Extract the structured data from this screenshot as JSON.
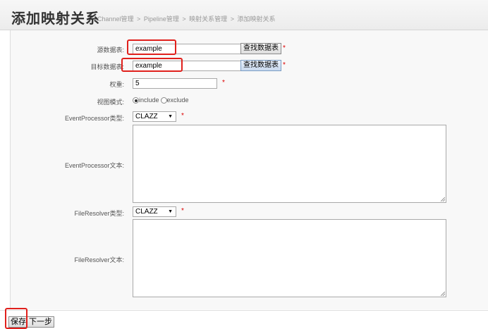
{
  "header": {
    "title": "添加映射关系",
    "breadcrumb": [
      "Channel管理",
      ">",
      "Pipeline管理",
      ">",
      "映射关系管理",
      ">",
      "添加映射关系"
    ]
  },
  "form": {
    "source_table": {
      "label": "源数据表:",
      "value": "example",
      "button": "查找数据表",
      "required": "*"
    },
    "target_table": {
      "label": "目标数据表:",
      "value": "example",
      "button": "查找数据表",
      "required": "*"
    },
    "weight": {
      "label": "权重:",
      "value": "5",
      "required": "*"
    },
    "view_mode": {
      "label": "视图模式:",
      "options": [
        "include",
        "exclude"
      ],
      "selected": "include"
    },
    "event_processor_type": {
      "label": "EventProcessor类型:",
      "value": "CLAZZ",
      "required": "*"
    },
    "event_processor_text": {
      "label": "EventProcessor文本:",
      "value": ""
    },
    "file_resolver_type": {
      "label": "FileResolver类型:",
      "value": "CLAZZ",
      "required": "*"
    },
    "file_resolver_text": {
      "label": "FileResolver文本:",
      "value": ""
    }
  },
  "footer": {
    "save_label": "保存",
    "next_label": "下一步"
  },
  "colors": {
    "highlight": "#e0201c",
    "required": "#dd0000",
    "content_bg": "#f8f8f8"
  }
}
